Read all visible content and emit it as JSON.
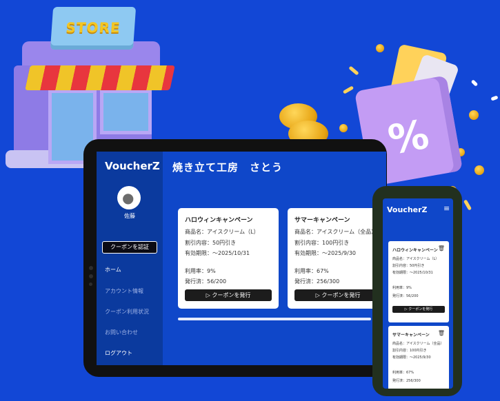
{
  "store_sign": "STORE",
  "bag_symbol": "%",
  "tablet": {
    "logo": "VoucherZ",
    "user_name": "佐藤",
    "verify_button": "クーポンを認証",
    "nav": [
      "ホーム",
      "アカウント情報",
      "クーポン利用状況",
      "お問い合わせ",
      "ログアウト"
    ],
    "shop_title": "焼き立て工房　さとう",
    "coupons": [
      {
        "title": "ハロウィンキャンペーン",
        "product": "商品名：アイスクリーム（L）",
        "discount": "割引内容：50円引き",
        "expiry": "有効期限：～2025/10/31",
        "usage": "利用率：9%",
        "issued": "発行済：56/200",
        "button": "クーポンを発行"
      },
      {
        "title": "サマーキャンペーン",
        "product": "商品名：アイスクリーム（全品）",
        "discount": "割引内容：100円引き",
        "expiry": "有効期限：～2025/9/30",
        "usage": "利用率：67%",
        "issued": "発行済：256/300",
        "button": "クーポンを発行"
      }
    ]
  },
  "phone": {
    "logo": "VoucherZ",
    "menu_icon": "≡",
    "coupons": [
      {
        "title": "ハロウィンキャンペーン",
        "product": "商品名：アイスクリーム（L）",
        "discount": "割引内容：50円引き",
        "expiry": "有効期限：～2025/10/31",
        "usage": "利用率：9%",
        "issued": "発行済：56/200",
        "button": "クーポンを発行"
      },
      {
        "title": "サマーキャンペーン",
        "product": "商品名：アイスクリーム（全品）",
        "discount": "割引内容：100円引き",
        "expiry": "有効期限：～2025/9/30",
        "usage": "利用率：67%",
        "issued": "発行済：256/300"
      }
    ]
  },
  "colors": {
    "background": "#1247d6",
    "sidebar": "#0b3a9e",
    "button": "#1c1c1c"
  }
}
